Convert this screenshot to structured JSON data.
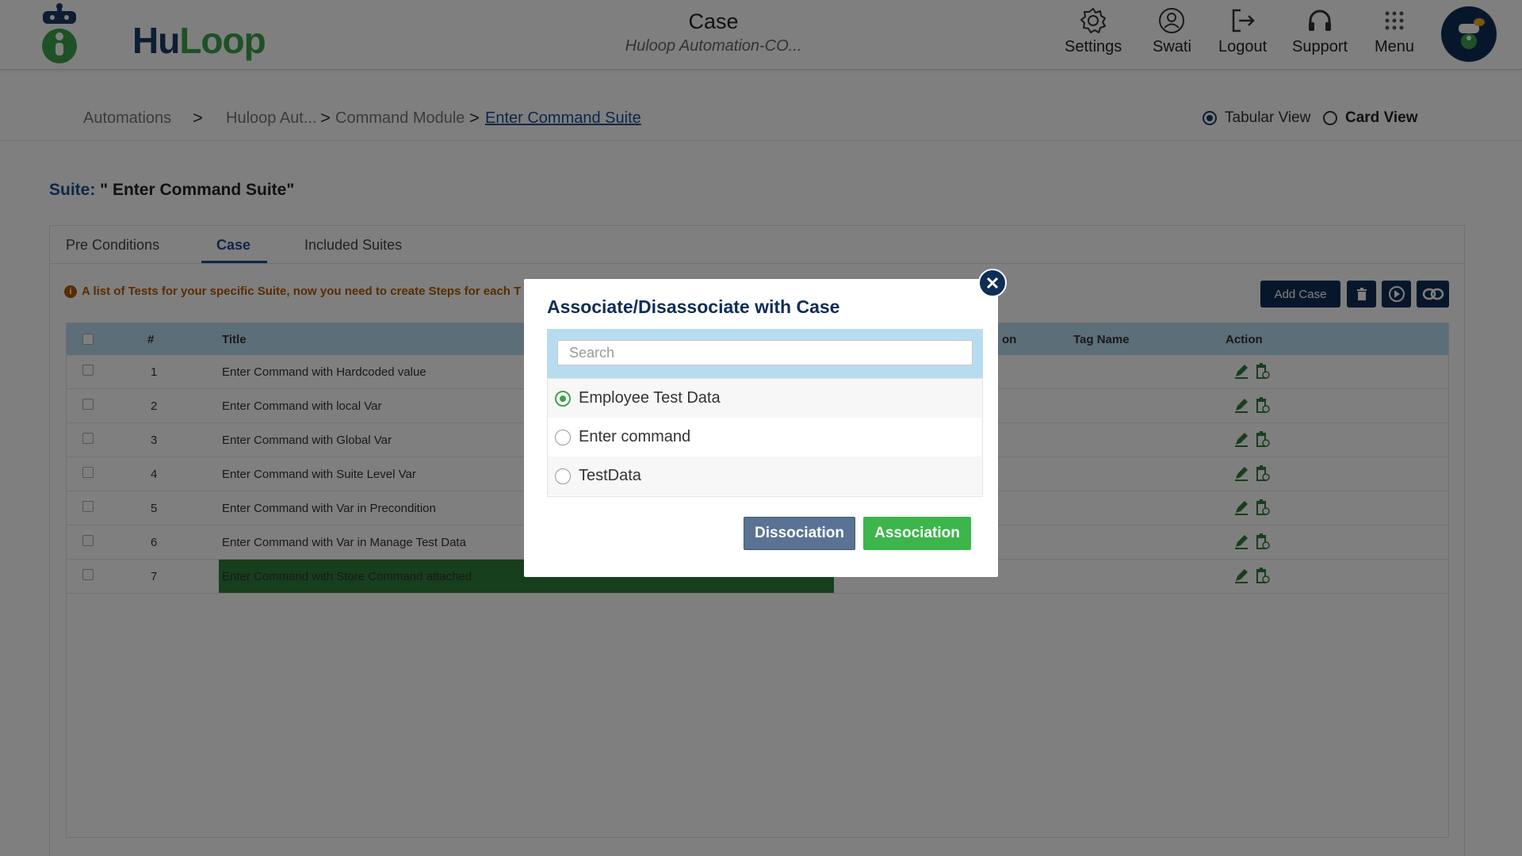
{
  "header": {
    "brand_hu": "Hu",
    "brand_loop": "Loop",
    "title": "Case",
    "subtitle": "Huloop Automation-CO...",
    "nav": [
      {
        "label": "Settings",
        "icon": "gear-icon"
      },
      {
        "label": "Swati",
        "icon": "user-icon"
      },
      {
        "label": "Logout",
        "icon": "logout-icon"
      },
      {
        "label": "Support",
        "icon": "headset-icon"
      },
      {
        "label": "Menu",
        "icon": "grid-icon"
      }
    ]
  },
  "breadcrumb": {
    "items": [
      "Automations",
      "Huloop Aut...",
      "Command Module",
      "Enter Command Suite"
    ],
    "separator": ">"
  },
  "view_toggle": {
    "tabular": "Tabular View",
    "card": "Card View",
    "selected": "Tabular View"
  },
  "suite": {
    "label": "Suite:",
    "name": " \" Enter Command Suite\""
  },
  "tabs": [
    "Pre Conditions",
    "Case",
    "Included Suites"
  ],
  "active_tab": "Case",
  "info_text": "A list of Tests for your specific Suite, now you need to create Steps for each T",
  "toolbar": {
    "add_case": "Add Case",
    "icons": [
      "trash-icon",
      "play-circle-icon",
      "link-icon"
    ]
  },
  "table": {
    "columns": [
      "#",
      "Title",
      "on",
      "Tag Name",
      "Action"
    ],
    "rows": [
      {
        "n": "1",
        "title": "Enter Command with Hardcoded value"
      },
      {
        "n": "2",
        "title": "Enter Command with local Var"
      },
      {
        "n": "3",
        "title": "Enter Command with Global Var"
      },
      {
        "n": "4",
        "title": "Enter Command with Suite Level Var"
      },
      {
        "n": "5",
        "title": "Enter Command with Var in Precondition"
      },
      {
        "n": "6",
        "title": "Enter Command with Var in Manage Test Data"
      },
      {
        "n": "7",
        "title": "Enter Command with Store Command attached",
        "highlighted": true
      }
    ]
  },
  "modal": {
    "title": "Associate/Disassociate with Case",
    "search_placeholder": "Search",
    "options": [
      {
        "label": "Employee Test Data",
        "selected": true
      },
      {
        "label": "Enter command",
        "selected": false
      },
      {
        "label": "TestData",
        "selected": false
      }
    ],
    "dissociation_label": "Dissociation",
    "association_label": "Association"
  },
  "colors": {
    "navy": "#0f2e57",
    "brand_green": "#3da24a",
    "table_header": "#b8dcef",
    "highlight_row": "#2f7d3a",
    "info_orange": "#b05a00",
    "dissociation": "#5a7394",
    "association": "#3cb54a"
  }
}
